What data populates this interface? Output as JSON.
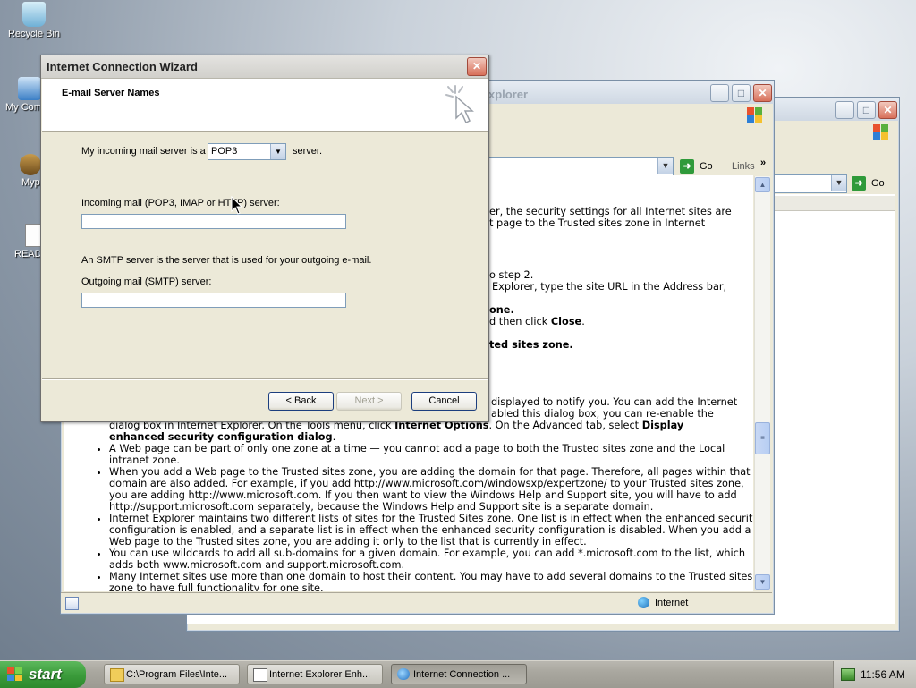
{
  "desktop": {
    "icons": [
      {
        "label": "Recycle Bin",
        "icon": "recycle-bin-icon"
      },
      {
        "label": "My Com",
        "icon": "my-computer-icon"
      },
      {
        "label": "Myp",
        "icon": "my-pictures-icon"
      },
      {
        "label": "READ",
        "icon": "readme-document-icon"
      }
    ]
  },
  "ie_back": {
    "title": "",
    "go_label": "Go"
  },
  "ie_front": {
    "title_fragment": "xplorer",
    "go_label": "Go",
    "links_label": "Links",
    "status_zone": "Internet",
    "lines": [
      "er, the security settings for all Internet sites are",
      "t page to the Trusted sites zone in Internet",
      "o step 2.",
      "Explorer, type the site URL in the Address bar,",
      "one.",
      "d then click ",
      "Close",
      "ted sites zone.",
      "displayed to notify you. You can add the Internet",
      "abled this dialog box, you can re-enable the",
      "dialog box in Internet Explorer. On the Tools menu, click ",
      "Internet Options",
      ". On the Advanced tab, select ",
      "Display",
      "enhanced security configuration dialog",
      "."
    ],
    "bullets": [
      "A Web page can be part of only one zone at a time — you cannot add a page to both the Trusted sites zone and the Local intranet zone.",
      "When you add a Web page to the Trusted sites zone, you are adding the domain for that page. Therefore, all pages within that domain are also added. For example, if you add http://www.microsoft.com/windowsxp/expertzone/ to your Trusted sites zone, you are adding http://www.microsoft.com. If you then want to view the Windows Help and Support site, you will have to add http://support.microsoft.com separately, because the Windows Help and Support site is a separate domain.",
      "Internet Explorer maintains two different lists of sites for the Trusted Sites zone. One list is in effect when the enhanced security configuration is enabled, and a separate list is in effect when the enhanced security configuration is disabled. When you add a Web page to the Trusted sites zone, you are adding it only to the list that is currently in effect.",
      "You can use wildcards to add all sub-domains for a given domain. For example, you can add *.microsoft.com to the list, which adds both www.microsoft.com and support.microsoft.com.",
      "Many Internet sites use more than one domain to host their content. You may have to add several domains to the Trusted sites zone to have full functionality for one site."
    ]
  },
  "wizard": {
    "title": "Internet Connection Wizard",
    "header_title": "E-mail Server Names",
    "incoming_prefix": "My incoming mail server is a",
    "server_type": "POP3",
    "incoming_suffix": "server.",
    "incoming_label": "Incoming mail (POP3, IMAP or HTTP) server:",
    "incoming_value": "",
    "smtp_note": "An SMTP server is the server that is used for your outgoing e-mail.",
    "outgoing_label": "Outgoing mail (SMTP) server:",
    "outgoing_value": "",
    "back_label": "< Back",
    "next_label": "Next >",
    "cancel_label": "Cancel"
  },
  "taskbar": {
    "start_label": "start",
    "tasks": [
      {
        "label": "C:\\Program Files\\Inte...",
        "icon": "folder-icon"
      },
      {
        "label": "Internet Explorer Enh...",
        "icon": "document-icon"
      },
      {
        "label": "Internet Connection ...",
        "icon": "ie-icon"
      }
    ],
    "clock": "11:56 AM"
  }
}
